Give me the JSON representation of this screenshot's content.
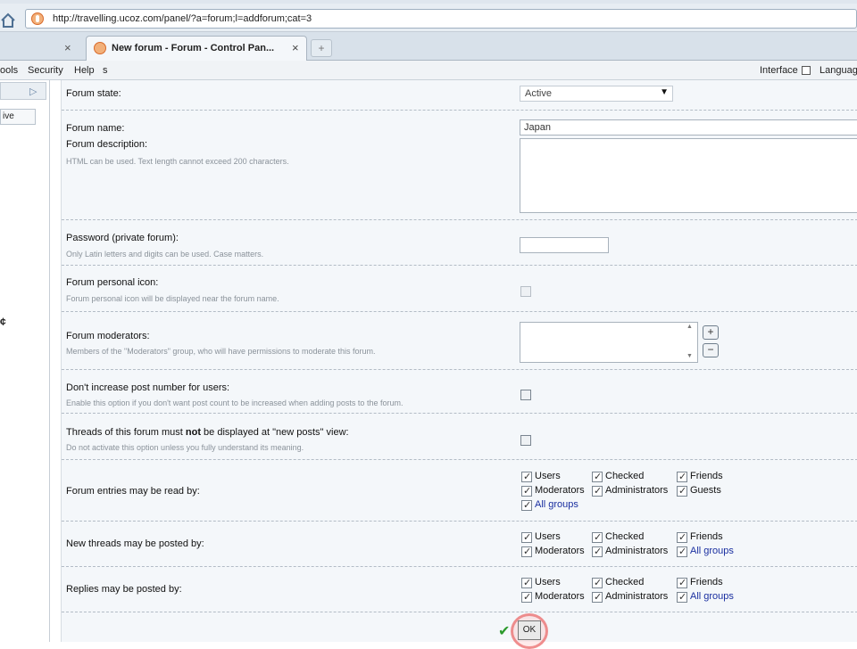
{
  "browser": {
    "url": "http://travelling.ucoz.com/panel/?a=forum;l=addforum;cat=3",
    "tab_title": "New forum - Forum - Control Pan...",
    "tab_close": "×",
    "new_tab": "+"
  },
  "menu": {
    "items": [
      "ools",
      "Security",
      "Help",
      "s"
    ],
    "right_items": [
      "Interface",
      "Languag"
    ]
  },
  "sidebar": {
    "arrow": "▷",
    "button_label": "ive",
    "mark": "¢"
  },
  "form": {
    "state": {
      "label": "Forum state:",
      "value": "Active"
    },
    "name": {
      "label": "Forum name:",
      "value": "Japan"
    },
    "description": {
      "label": "Forum description:",
      "hint": "HTML can be used. Text length cannot exceed 200 characters."
    },
    "password": {
      "label": "Password (private forum):",
      "hint": "Only Latin letters and digits can be used. Case matters."
    },
    "icon": {
      "label": "Forum personal icon:",
      "hint": "Forum personal icon will be displayed near the forum name."
    },
    "moderators": {
      "label": "Forum moderators:",
      "hint": "Members of the \"Moderators\" group, who will have permissions to moderate this forum.",
      "add": "+",
      "remove": "−"
    },
    "no_increase": {
      "label": "Don't increase post number for users:",
      "hint": "Enable this option if you don't want post count to be increased when adding posts to the forum."
    },
    "new_posts": {
      "label_a": "Threads of this forum must ",
      "label_b": "not",
      "label_c": " be displayed at \"new posts\" view:",
      "hint": "Do not activate this option unless you fully understand its meaning."
    },
    "read_by": {
      "label": "Forum entries may be read by:",
      "options": [
        "Users",
        "Checked",
        "Friends",
        "Moderators",
        "Administrators",
        "Guests",
        "All groups"
      ]
    },
    "threads_by": {
      "label": "New threads may be posted by:",
      "options": [
        "Users",
        "Checked",
        "Friends",
        "Moderators",
        "Administrators",
        "All groups"
      ]
    },
    "replies_by": {
      "label": "Replies may be posted by:",
      "options": [
        "Users",
        "Checked",
        "Friends",
        "Moderators",
        "Administrators",
        "All groups"
      ]
    }
  },
  "submit": {
    "check": "✔",
    "label": "OK"
  }
}
